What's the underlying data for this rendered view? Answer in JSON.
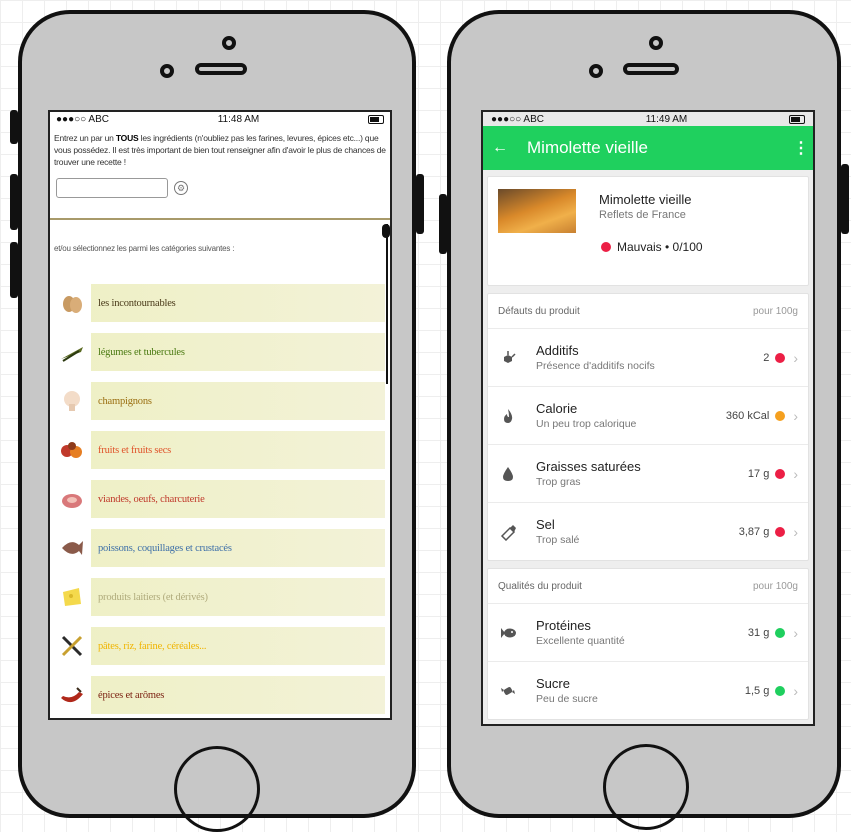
{
  "left": {
    "status": {
      "carrier": "●●●○○ ABC",
      "time": "11:48 AM"
    },
    "intro_prefix": "Entrez un par un",
    "intro_bold": "TOUS",
    "intro_rest": "les ingrédients (n'oubliez pas les farines, levures, épices etc...) que vous possédez. Il est très important de bien tout renseigner afin d'avoir le plus de chances de trouver une recette !",
    "categories_heading": "et/ou sélectionnez les parmi les catégories suivantes :",
    "categories": [
      {
        "label": "les incontournables",
        "color": "#4a3a1a",
        "icon": "eggs-icon"
      },
      {
        "label": "légumes et tubercules",
        "color": "#4b7a12",
        "icon": "vegetables-icon"
      },
      {
        "label": "champignons",
        "color": "#9a6e10",
        "icon": "mushroom-icon"
      },
      {
        "label": "fruits et fruits secs",
        "color": "#e0532a",
        "icon": "fruits-icon"
      },
      {
        "label": "viandes, oeufs, charcuterie",
        "color": "#c0392b",
        "icon": "meat-icon"
      },
      {
        "label": "poissons, coquillages et crustacés",
        "color": "#3d6fa8",
        "icon": "fish-icon"
      },
      {
        "label": "produits laitiers (et dérivés)",
        "color": "#b0ab7c",
        "icon": "cheese-icon"
      },
      {
        "label": "pâtes, riz, farine, céréales...",
        "color": "#f0b400",
        "icon": "pasta-icon"
      },
      {
        "label": "épices et arômes",
        "color": "#7a1f10",
        "icon": "spices-icon"
      }
    ]
  },
  "right": {
    "status": {
      "carrier": "●●●○○ ABC",
      "time": "11:49 AM"
    },
    "app_title": "Mimolette vieille",
    "product": {
      "name": "Mimolette vieille",
      "brand": "Reflets de France",
      "score_text": "Mauvais • 0/100",
      "score_color": "#ec1f45"
    },
    "defects": {
      "title": "Défauts du produit",
      "per": "pour 100g",
      "rows": [
        {
          "title": "Additifs",
          "sub": "Présence d'additifs nocifs",
          "value": "2",
          "status": "red",
          "icon": "additives-icon"
        },
        {
          "title": "Calorie",
          "sub": "Un peu trop calorique",
          "value": "360 kCal",
          "status": "orange",
          "icon": "flame-icon"
        },
        {
          "title": "Graisses saturées",
          "sub": "Trop gras",
          "value": "17 g",
          "status": "red",
          "icon": "drop-icon"
        },
        {
          "title": "Sel",
          "sub": "Trop salé",
          "value": "3,87 g",
          "status": "red",
          "icon": "salt-icon"
        }
      ]
    },
    "qualities": {
      "title": "Qualités du produit",
      "per": "pour 100g",
      "rows": [
        {
          "title": "Protéines",
          "sub": "Excellente quantité",
          "value": "31 g",
          "status": "green",
          "icon": "fish-protein-icon"
        },
        {
          "title": "Sucre",
          "sub": "Peu de sucre",
          "value": "1,5 g",
          "status": "green",
          "icon": "candy-icon"
        }
      ]
    },
    "accent_color": "#1fd05e"
  }
}
